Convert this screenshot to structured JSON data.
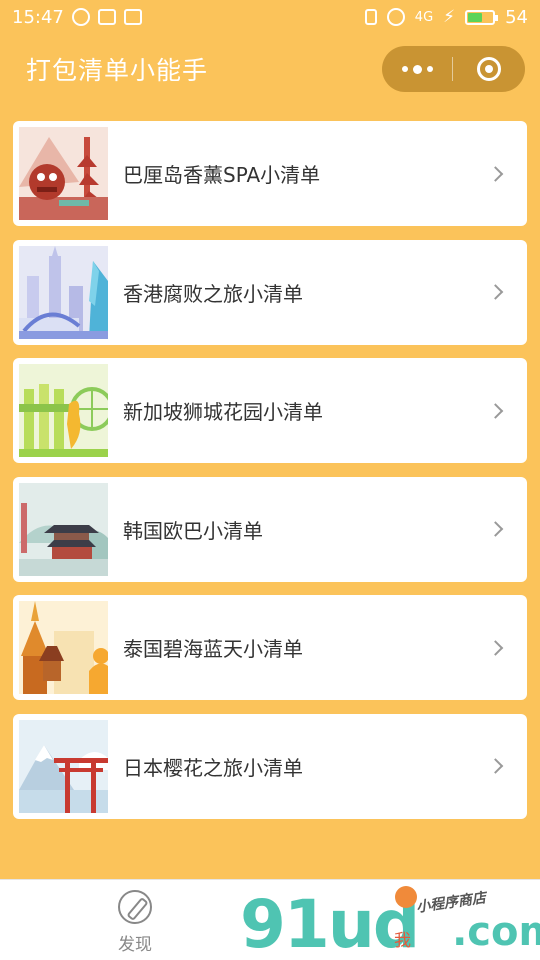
{
  "status_bar": {
    "time": "15:47",
    "network": "4G",
    "battery_percent": "54",
    "battery_level": 0.54
  },
  "header": {
    "title": "打包清单小能手"
  },
  "list": {
    "items": [
      {
        "label": "巴厘岛香薰SPA小清单",
        "icon": "bali-thumbnail"
      },
      {
        "label": "香港腐败之旅小清单",
        "icon": "hongkong-thumbnail"
      },
      {
        "label": "新加坡狮城花园小清单",
        "icon": "singapore-thumbnail"
      },
      {
        "label": "韩国欧巴小清单",
        "icon": "korea-thumbnail"
      },
      {
        "label": "泰国碧海蓝天小清单",
        "icon": "thailand-thumbnail"
      },
      {
        "label": "日本樱花之旅小清单",
        "icon": "japan-thumbnail"
      }
    ]
  },
  "tabbar": {
    "discover_label": "发现",
    "me_label": "我"
  },
  "watermark": {
    "main": "91ud",
    "com": ".com",
    "sub": "小程序商店"
  },
  "colors": {
    "background": "#fbc35a",
    "card": "#ffffff",
    "watermark": "#4fc4b2"
  }
}
